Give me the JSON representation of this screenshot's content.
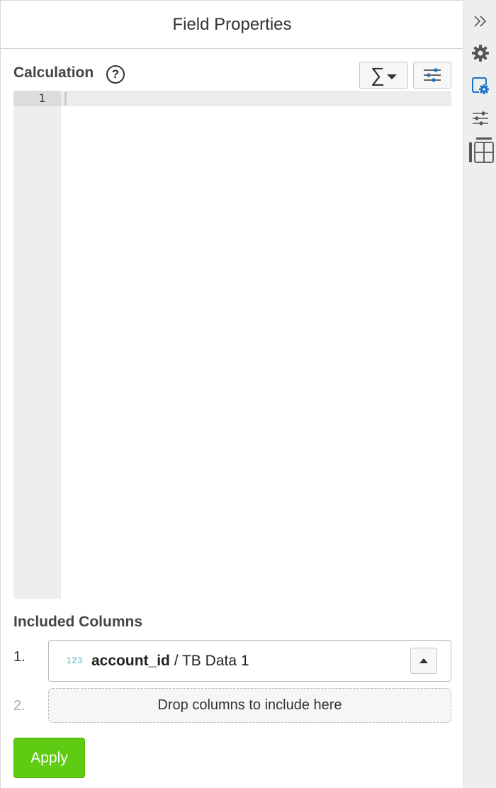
{
  "header": {
    "title": "Field Properties"
  },
  "calculation": {
    "label": "Calculation",
    "help_glyph": "?",
    "functions_glyph": "∑",
    "editor": {
      "line_number": "1",
      "code": ""
    }
  },
  "included_columns": {
    "label": "Included Columns",
    "items": [
      {
        "index": "1.",
        "type_badge": "123",
        "name": "account_id",
        "source": " / TB Data 1"
      }
    ],
    "drop": {
      "index": "2.",
      "text": "Drop columns to include here"
    }
  },
  "apply": {
    "label": "Apply"
  },
  "rail": {
    "icons": [
      "double-chevron-right-icon",
      "gear-icon",
      "field-settings-icon",
      "sliders-icon",
      "table-layout-icon"
    ],
    "active_color": "#1a73c9"
  },
  "colors": {
    "accent_green": "#5fcc13",
    "type_badge": "#35b8c9"
  }
}
